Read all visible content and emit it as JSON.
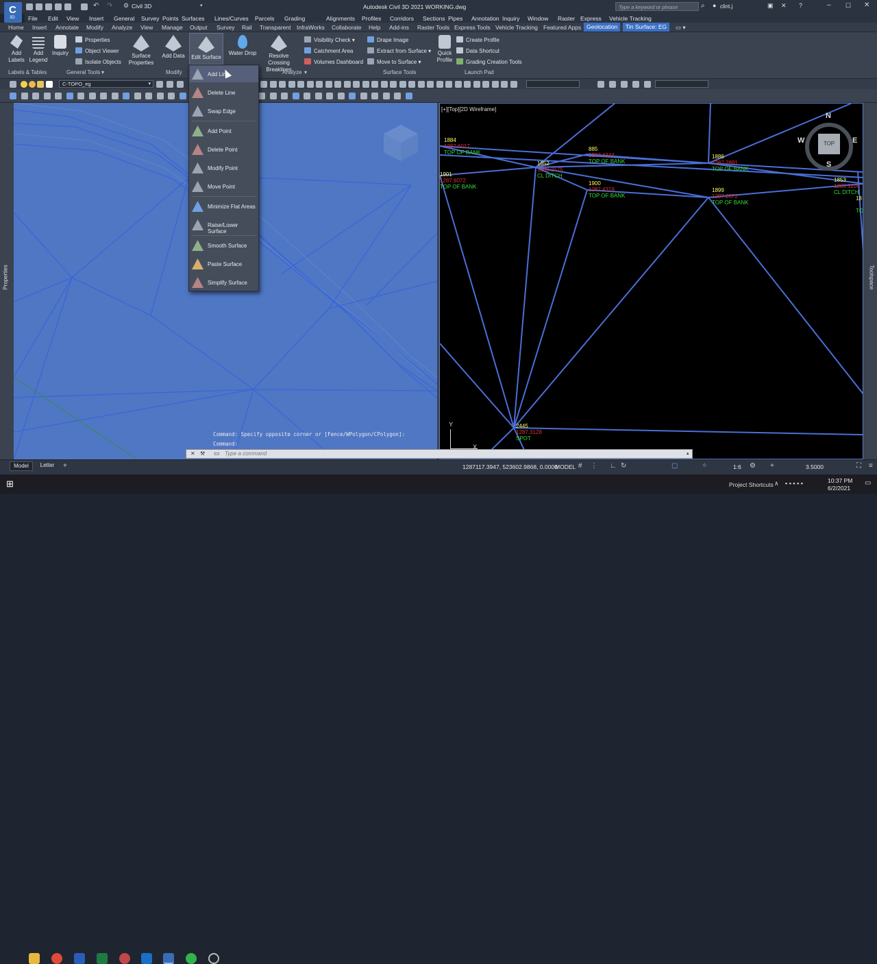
{
  "titlebar": {
    "app_letter": "C",
    "app_sub": "3D",
    "workspace": "Civil 3D",
    "title": "Autodesk Civil 3D 2021    WORKING.dwg",
    "search_placeholder": "Type a keyword or phrase",
    "user": "clint.j"
  },
  "menubar": [
    "File",
    "Edit",
    "View",
    "Insert",
    "General",
    "Survey",
    "Points",
    "Surfaces",
    "Lines/Curves",
    "Parcels",
    "Grading",
    "Alignments",
    "Profiles",
    "Corridors",
    "Sections",
    "Pipes",
    "Annotation",
    "Inquiry",
    "Window",
    "Raster",
    "Express",
    "Vehicle Tracking"
  ],
  "ribbon_tabs": [
    "Home",
    "Insert",
    "Annotate",
    "Modify",
    "Analyze",
    "View",
    "Manage",
    "Output",
    "Survey",
    "Rail",
    "Transparent",
    "InfraWorks",
    "Collaborate",
    "Help",
    "Add-ins",
    "Raster Tools",
    "Express Tools",
    "Vehicle Tracking",
    "Featured Apps",
    "Geolocation",
    "Tin Surface: EG"
  ],
  "ribbon": {
    "add_labels": "Add Labels",
    "add_legend": "Add Legend",
    "inquiry": "Inquiry",
    "properties": "Properties",
    "object_viewer": "Object Viewer",
    "isolate_objects": "Isolate Objects",
    "surface_properties": "Surface Properties",
    "add_data": "Add Data",
    "edit_surface": "Edit Surface",
    "water_drop": "Water Drop",
    "resolve_crossing": "Resolve Crossing Breaklines",
    "visibility_check": "Visibility Check",
    "catchment_area": "Catchment Area",
    "volumes_dashboard": "Volumes Dashboard",
    "drape_image": "Drape Image",
    "extract_from_surface": "Extract from Surface",
    "move_to_surface": "Move to Surface",
    "quick_profile": "Quick Profile",
    "create_profile": "Create Profile",
    "data_shortcut": "Data Shortcut",
    "grading_creation_tools": "Grading Creation Tools",
    "panels": {
      "labels_tables": "Labels & Tables",
      "general_tools": "General Tools",
      "modify": "Modify",
      "analyze": "Analyze",
      "surface_tools": "Surface Tools",
      "launch_pad": "Launch Pad"
    }
  },
  "layer": "C-TOPO_eg",
  "edit_surface_menu": [
    "Add Line",
    "Delete Line",
    "Swap Edge",
    "Add Point",
    "Delete Point",
    "Modify Point",
    "Move Point",
    "Minimize Flat Areas",
    "Raise/Lower Surface",
    "Smooth Surface",
    "Paste Surface",
    "Simplify Surface"
  ],
  "viewport_right": {
    "label": "[+][Top][2D Wireframe]",
    "viewcube": {
      "top": "TOP",
      "n": "N",
      "s": "S",
      "e": "E",
      "w": "W"
    },
    "points": [
      {
        "num": "1884",
        "elev": "1287.6017",
        "desc": "TOP OF BANK"
      },
      {
        "num": "1901",
        "elev": "1287.6072",
        "desc": "TOP OF BANK"
      },
      {
        "num": "1852",
        "elev": "1286.2175",
        "desc": "CL DITCH"
      },
      {
        "num": "885",
        "elev": "1287.4344",
        "desc": "TOP OF BANK"
      },
      {
        "num": "1900",
        "elev": "1287.4319",
        "desc": "TOP OF BANK"
      },
      {
        "num": "1886",
        "elev": "1287.2891",
        "desc": "TOP OF BANK"
      },
      {
        "num": "1899",
        "elev": "1287.2872",
        "desc": "TOP OF BANK"
      },
      {
        "num": "1853",
        "elev": "1286.1104",
        "desc": "CL DITCH"
      },
      {
        "num": "18",
        "elev": "",
        "desc": "TO"
      },
      {
        "num": "2445",
        "elev": "1287.3128",
        "desc": "SPOT"
      }
    ],
    "ucs_y": "Y",
    "ucs_x": "X"
  },
  "side_labels": {
    "properties": "Properties",
    "toolspace": "Toolspace"
  },
  "command": {
    "history1": "Command: Specify opposite corner or [Fence/WPolygon/CPolygon]:",
    "history2": "Command:",
    "placeholder": "Type a command"
  },
  "status": {
    "tabs": [
      "Model",
      "Letter"
    ],
    "coords": "1287117.3947, 523602.9868, 0.0000",
    "model": "MODEL",
    "scale": "1:6",
    "value": "3.5000"
  },
  "taskbar": {
    "project_shortcuts": "Project Shortcuts",
    "time": "10:37 PM",
    "date": "6/2/2021"
  },
  "colors": {
    "accent": "#3b70c4",
    "tin_line": "#4a6fd8",
    "point_num": "#ffff66",
    "point_elev": "#e03030",
    "point_desc": "#33dd33"
  }
}
